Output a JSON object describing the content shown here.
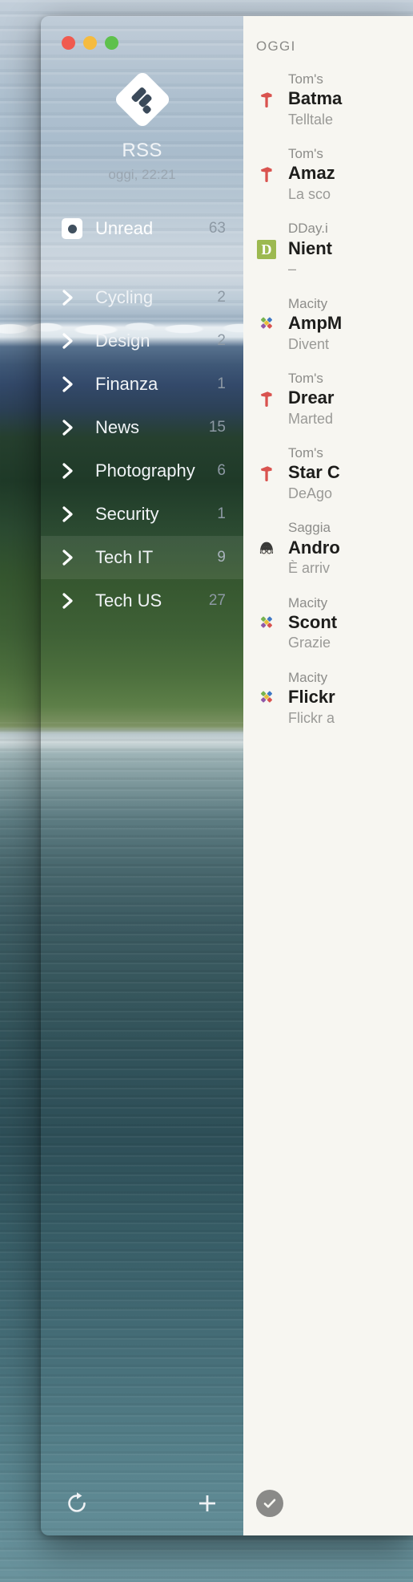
{
  "window": {
    "traffic_lights": {
      "close_color": "#f05a4f",
      "minimize_color": "#f5bb3e",
      "maximize_color": "#5ec14c"
    }
  },
  "sidebar": {
    "account_title": "RSS",
    "account_subtitle": "oggi, 22:21",
    "logo_icon": "feedly-logo-icon",
    "unread": {
      "label": "Unread",
      "count": "63",
      "icon": "unread-dot-icon"
    },
    "categories": [
      {
        "label": "Cycling",
        "count": "2",
        "icon": "chevron-right-icon",
        "selected": false
      },
      {
        "label": "Design",
        "count": "2",
        "icon": "chevron-right-icon",
        "selected": false
      },
      {
        "label": "Finanza",
        "count": "1",
        "icon": "chevron-right-icon",
        "selected": false
      },
      {
        "label": "News",
        "count": "15",
        "icon": "chevron-right-icon",
        "selected": false
      },
      {
        "label": "Photography",
        "count": "6",
        "icon": "chevron-right-icon",
        "selected": false
      },
      {
        "label": "Security",
        "count": "1",
        "icon": "chevron-right-icon",
        "selected": false
      },
      {
        "label": "Tech IT",
        "count": "9",
        "icon": "chevron-right-icon",
        "selected": true
      },
      {
        "label": "Tech US",
        "count": "27",
        "icon": "chevron-right-icon",
        "selected": false
      }
    ],
    "toolbar": {
      "refresh_icon": "refresh-icon",
      "add_icon": "plus-icon"
    }
  },
  "articles": {
    "date_header": "OGGI",
    "items": [
      {
        "source": "Tom's",
        "title": "Batma",
        "snippet": "Telltale",
        "favicon": "toms-hardware-hammer-icon"
      },
      {
        "source": "Tom's",
        "title": "Amaz",
        "snippet": "La sco",
        "favicon": "toms-hardware-hammer-icon"
      },
      {
        "source": "DDay.i",
        "title": "Nient",
        "snippet": "–",
        "favicon": "dday-d-icon"
      },
      {
        "source": "Macity",
        "title": "AmpM",
        "snippet": "Divent",
        "favicon": "macitynet-mosaic-icon"
      },
      {
        "source": "Tom's",
        "title": "Drear",
        "snippet": "Marted",
        "favicon": "toms-hardware-hammer-icon"
      },
      {
        "source": "Tom's",
        "title": "Star C",
        "snippet": "DeAgo",
        "favicon": "toms-hardware-hammer-icon"
      },
      {
        "source": "Saggia",
        "title": "Andro",
        "snippet": "È arriv",
        "favicon": "saggiamente-face-icon"
      },
      {
        "source": "Macity",
        "title": "Scont",
        "snippet": "Grazie",
        "favicon": "macitynet-mosaic-icon"
      },
      {
        "source": "Macity",
        "title": "Flickr",
        "snippet": "Flickr a",
        "favicon": "macitynet-mosaic-icon"
      }
    ],
    "toolbar": {
      "mark_all_read_icon": "check-circle-icon"
    }
  },
  "colors": {
    "sidebar_top": "#39485a",
    "sidebar_mid": "#233129",
    "panel_bg": "#f7f6f1",
    "accent_red": "#d9534f",
    "accent_green": "#9cb950"
  }
}
